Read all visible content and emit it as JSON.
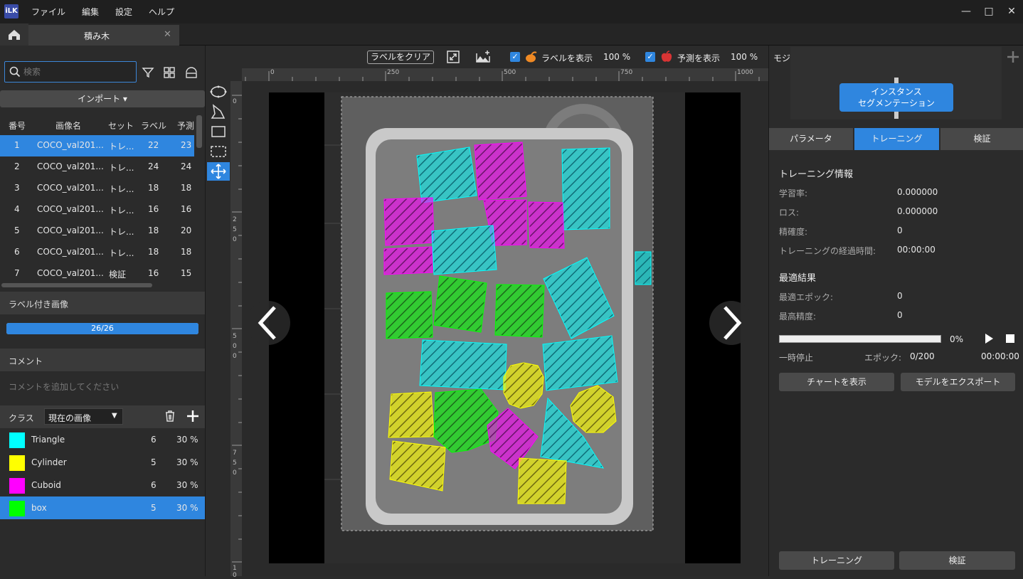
{
  "app": {
    "logo_text": "iLK",
    "menu": [
      "ファイル",
      "編集",
      "設定",
      "ヘルプ"
    ],
    "window_controls": [
      "minimize",
      "maximize",
      "close"
    ]
  },
  "tabs": {
    "home_icon": "home-icon",
    "doc_tab_label": "積み木"
  },
  "left": {
    "search_placeholder": "検索",
    "import_label": "インポート ▾",
    "table": {
      "headers": [
        "番号",
        "画像名",
        "セット",
        "ラベル",
        "予測"
      ],
      "rows": [
        [
          "1",
          "COCO_val201...",
          "トレ...",
          "22",
          "23"
        ],
        [
          "2",
          "COCO_val201...",
          "トレ...",
          "24",
          "24"
        ],
        [
          "3",
          "COCO_val201...",
          "トレ...",
          "18",
          "18"
        ],
        [
          "4",
          "COCO_val201...",
          "トレ...",
          "16",
          "16"
        ],
        [
          "5",
          "COCO_val201...",
          "トレ...",
          "18",
          "20"
        ],
        [
          "6",
          "COCO_val201...",
          "トレ...",
          "18",
          "18"
        ],
        [
          "7",
          "COCO_val201...",
          "検証",
          "16",
          "15"
        ]
      ]
    },
    "labeled_images_title": "ラベル付き画像",
    "labeled_progress_text": "26/26",
    "labeled_progress_fraction": 1.0,
    "comment_title": "コメント",
    "comment_placeholder": "コメントを追加してください",
    "class_label": "クラス",
    "class_filter": "現在の画像",
    "classes": [
      {
        "name": "Triangle",
        "count": "6",
        "pct": "30 %",
        "color": "#00ffff"
      },
      {
        "name": "Cylinder",
        "count": "5",
        "pct": "30 %",
        "color": "#ffff00"
      },
      {
        "name": "Cuboid",
        "count": "6",
        "pct": "30 %",
        "color": "#ff00ff"
      },
      {
        "name": "box",
        "count": "5",
        "pct": "30 %",
        "color": "#00ff00"
      }
    ]
  },
  "canvas": {
    "clear_labels": "ラベルをクリア",
    "show_labels": "ラベルを表示",
    "show_labels_pct": "100 %",
    "show_pred": "予測を表示",
    "show_pred_pct": "100 %",
    "ruler_top": [
      "0",
      "250",
      "500",
      "750",
      "1000"
    ],
    "ruler_left": [
      "0",
      "2\n5\n0",
      "5\n0\n0",
      "7\n5\n0",
      "1\n0"
    ]
  },
  "right": {
    "module_title": "モジュール",
    "module_node": "インスタンス\nセグメンテーション",
    "tabs": [
      "パラメータ",
      "トレーニング",
      "検証"
    ],
    "training_info_title": "トレーニング情報",
    "training_info": [
      {
        "label": "学習率:",
        "value": "0.000000"
      },
      {
        "label": "ロス:",
        "value": "0.000000"
      },
      {
        "label": "精確度:",
        "value": "0"
      },
      {
        "label": "トレーニングの経過時間:",
        "value": "00:00:00"
      }
    ],
    "best_title": "最適結果",
    "best": [
      {
        "label": "最適エポック:",
        "value": "0"
      },
      {
        "label": "最高精度:",
        "value": "0"
      }
    ],
    "progress_pct": "0%",
    "progress_fraction": 0,
    "status": "一時停止",
    "epoch_label": "エポック:",
    "epoch_value": "0/200",
    "elapsed": "00:00:00",
    "show_chart": "チャートを表示",
    "export_model": "モデルをエクスポート",
    "train_button": "トレーニング",
    "validate_button": "検証"
  }
}
